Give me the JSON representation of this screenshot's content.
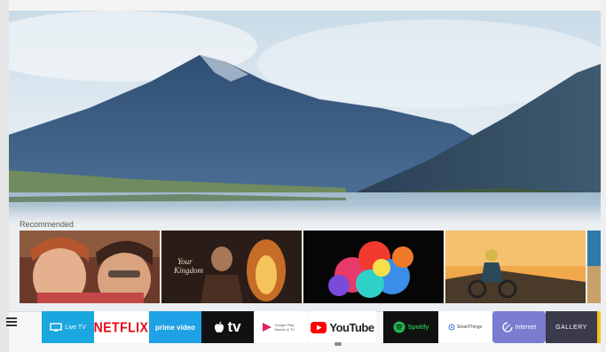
{
  "recommended": {
    "label": "Recommended"
  },
  "apps": [
    {
      "id": "livetv",
      "label": "Live TV",
      "bg": "#1aa7e0",
      "fg": "#ffffff",
      "icon": "tv-icon"
    },
    {
      "id": "netflix",
      "label": "NETFLIX",
      "bg": "#ffffff",
      "fg": "#e50914"
    },
    {
      "id": "prime",
      "label": "prime video",
      "bg": "#1fa1e6",
      "fg": "#ffffff"
    },
    {
      "id": "appletv",
      "label": "tv",
      "bg": "#111111",
      "fg": "#ffffff",
      "icon": "apple-icon"
    },
    {
      "id": "googleplay",
      "label": "Google Play Movies & TV",
      "bg": "#ffffff",
      "fg": "#555555",
      "icon": "play-icon"
    },
    {
      "id": "youtube",
      "label": "YouTube",
      "bg": "#ffffff",
      "fg": "#222222",
      "icon": "youtube-play-icon"
    },
    {
      "id": "spotify",
      "label": "Spotify",
      "bg": "#111111",
      "fg": "#1db954",
      "icon": "spotify-icon"
    },
    {
      "id": "smartthings",
      "label": "SmartThings",
      "bg": "#ffffff",
      "fg": "#444444",
      "icon": "smartthings-icon"
    },
    {
      "id": "internet",
      "label": "Internet",
      "bg": "#7a7cd0",
      "fg": "#ffffff",
      "icon": "internet-icon"
    },
    {
      "id": "gallery",
      "label": "GALLERY",
      "bg": "#3a3a4a",
      "fg": "#ffffff"
    }
  ],
  "colors": {
    "netflix_red": "#e50914",
    "youtube_red": "#ff0000",
    "spotify_green": "#1db954",
    "accent_yellow": "#f0c419"
  }
}
